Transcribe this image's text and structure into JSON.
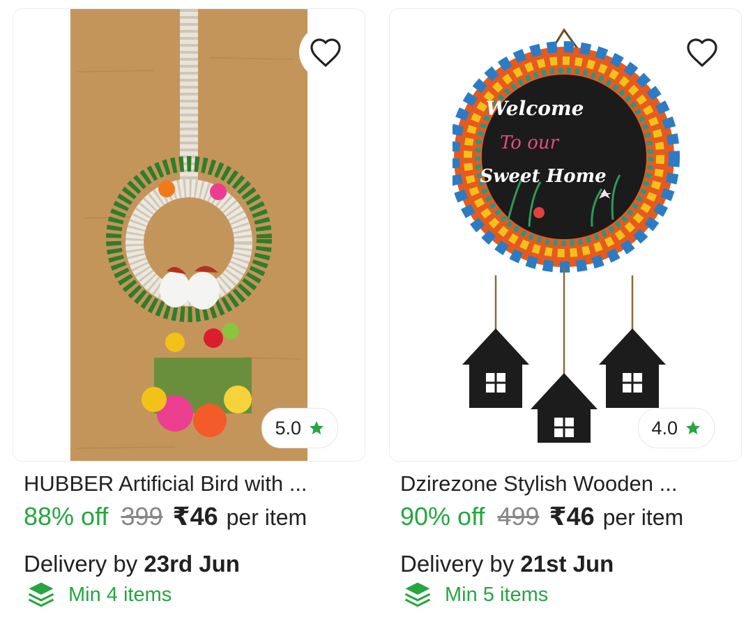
{
  "colors": {
    "green": "#26a541",
    "star": "#26a541",
    "strike": "#878787"
  },
  "icons": {
    "wishlist": "heart-outline-icon",
    "rating": "star-icon",
    "moq": "layers-stack-icon"
  },
  "products": [
    {
      "title": "HUBBER Artificial Bird with ...",
      "discount": "88% off",
      "mrp": "399",
      "price": "₹46",
      "unit": "per item",
      "delivery_prefix": "Delivery by",
      "delivery_date": "23rd Jun",
      "min_items": "Min 4 items",
      "rating": "5.0"
    },
    {
      "title": "Dzirezone Stylish Wooden ...",
      "discount": "90% off",
      "mrp": "499",
      "price": "₹46",
      "unit": "per item",
      "delivery_prefix": "Delivery by",
      "delivery_date": "21st Jun",
      "min_items": "Min 5 items",
      "rating": "4.0",
      "sign_text": [
        "Welcome",
        "To our",
        "Sweet Home"
      ]
    }
  ]
}
